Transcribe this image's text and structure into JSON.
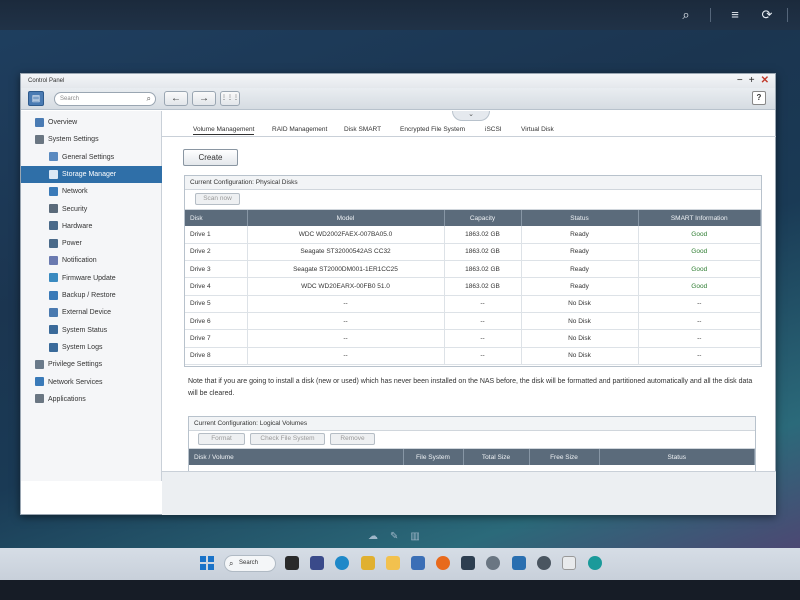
{
  "window": {
    "title": "Control Panel",
    "controls": {
      "minimize": "−",
      "maximize": "+",
      "close": "✕"
    }
  },
  "toolbar": {
    "search_placeholder": "Search",
    "back": "←",
    "forward": "→",
    "grid": "⋮⋮⋮",
    "help": "?"
  },
  "sidebar": {
    "items": [
      {
        "label": "Overview",
        "icon": "overview-icon",
        "level": 0
      },
      {
        "label": "System Settings",
        "icon": "gear-icon",
        "level": 0
      },
      {
        "label": "General Settings",
        "icon": "general-settings-icon",
        "level": 1
      },
      {
        "label": "Storage Manager",
        "icon": "storage-icon",
        "level": 1,
        "active": true
      },
      {
        "label": "Network",
        "icon": "network-icon",
        "level": 1
      },
      {
        "label": "Security",
        "icon": "lock-icon",
        "level": 1
      },
      {
        "label": "Hardware",
        "icon": "hardware-icon",
        "level": 1
      },
      {
        "label": "Power",
        "icon": "power-icon",
        "level": 1
      },
      {
        "label": "Notification",
        "icon": "notification-icon",
        "level": 1
      },
      {
        "label": "Firmware Update",
        "icon": "firmware-icon",
        "level": 1
      },
      {
        "label": "Backup / Restore",
        "icon": "backup-icon",
        "level": 1
      },
      {
        "label": "External Device",
        "icon": "external-device-icon",
        "level": 1
      },
      {
        "label": "System Status",
        "icon": "system-status-icon",
        "level": 1
      },
      {
        "label": "System Logs",
        "icon": "logs-icon",
        "level": 1
      },
      {
        "label": "Privilege Settings",
        "icon": "user-icon",
        "level": 0
      },
      {
        "label": "Network Services",
        "icon": "network-services-icon",
        "level": 0
      },
      {
        "label": "Applications",
        "icon": "applications-icon",
        "level": 0
      }
    ]
  },
  "tabs": [
    "Volume Management",
    "RAID Management",
    "Disk SMART",
    "Encrypted File System",
    "iSCSI",
    "Virtual Disk"
  ],
  "create_label": "Create",
  "physical_disks": {
    "title": "Current Configuration: Physical Disks",
    "scan_label": "Scan now",
    "columns": [
      "Disk",
      "Model",
      "Capacity",
      "Status",
      "SMART Information"
    ],
    "rows": [
      [
        "Drive 1",
        "WDC WD2002FAEX-007BA05.0",
        "1863.02 GB",
        "Ready",
        "Good"
      ],
      [
        "Drive 2",
        "Seagate ST32000542AS CC32",
        "1863.02 GB",
        "Ready",
        "Good"
      ],
      [
        "Drive 3",
        "Seagate ST2000DM001-1ER1CC25",
        "1863.02 GB",
        "Ready",
        "Good"
      ],
      [
        "Drive 4",
        "WDC WD20EARX-00FB0 51.0",
        "1863.02 GB",
        "Ready",
        "Good"
      ],
      [
        "Drive 5",
        "--",
        "--",
        "No Disk",
        "--"
      ],
      [
        "Drive 6",
        "--",
        "--",
        "No Disk",
        "--"
      ],
      [
        "Drive 7",
        "--",
        "--",
        "No Disk",
        "--"
      ],
      [
        "Drive 8",
        "--",
        "--",
        "No Disk",
        "--"
      ]
    ]
  },
  "note": "Note that if you are going to install a disk (new or used) which has never been installed on the NAS before, the disk will be formatted and partitioned automatically and all the disk data will be cleared.",
  "logical_volumes": {
    "title": "Current Configuration: Logical Volumes",
    "buttons": [
      "Format",
      "Check File System",
      "Remove"
    ],
    "columns": [
      "Disk / Volume",
      "File System",
      "Total Size",
      "Free Size",
      "Status"
    ]
  },
  "taskbar": {
    "search_label": "Search"
  },
  "colors": {
    "accent": "#2f6fa8",
    "table_header": "#5b6b7b",
    "good": "#2e7d32"
  }
}
